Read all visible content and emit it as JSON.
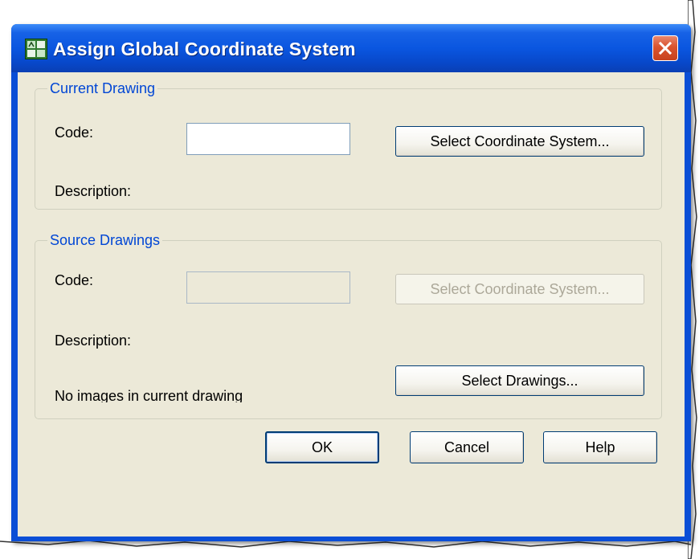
{
  "window": {
    "title": "Assign Global Coordinate System",
    "title_icon": "autocad-map-icon",
    "close_icon": "close-icon"
  },
  "current_drawing": {
    "legend": "Current Drawing",
    "code_label": "Code:",
    "code_value": "",
    "description_label": "Description:",
    "select_cs_button": "Select Coordinate System..."
  },
  "source_drawings": {
    "legend": "Source Drawings",
    "code_label": "Code:",
    "code_value": "",
    "description_label": "Description:",
    "select_cs_button": "Select Coordinate System...",
    "select_drawings_button": "Select Drawings...",
    "status_text": "No images in current drawing"
  },
  "footer": {
    "ok": "OK",
    "cancel": "Cancel",
    "help": "Help"
  },
  "colors": {
    "titlebar": "#0A56E0",
    "legend_text": "#0046D5",
    "dialog_bg": "#ECE9D8",
    "close_button": "#D9532E"
  }
}
